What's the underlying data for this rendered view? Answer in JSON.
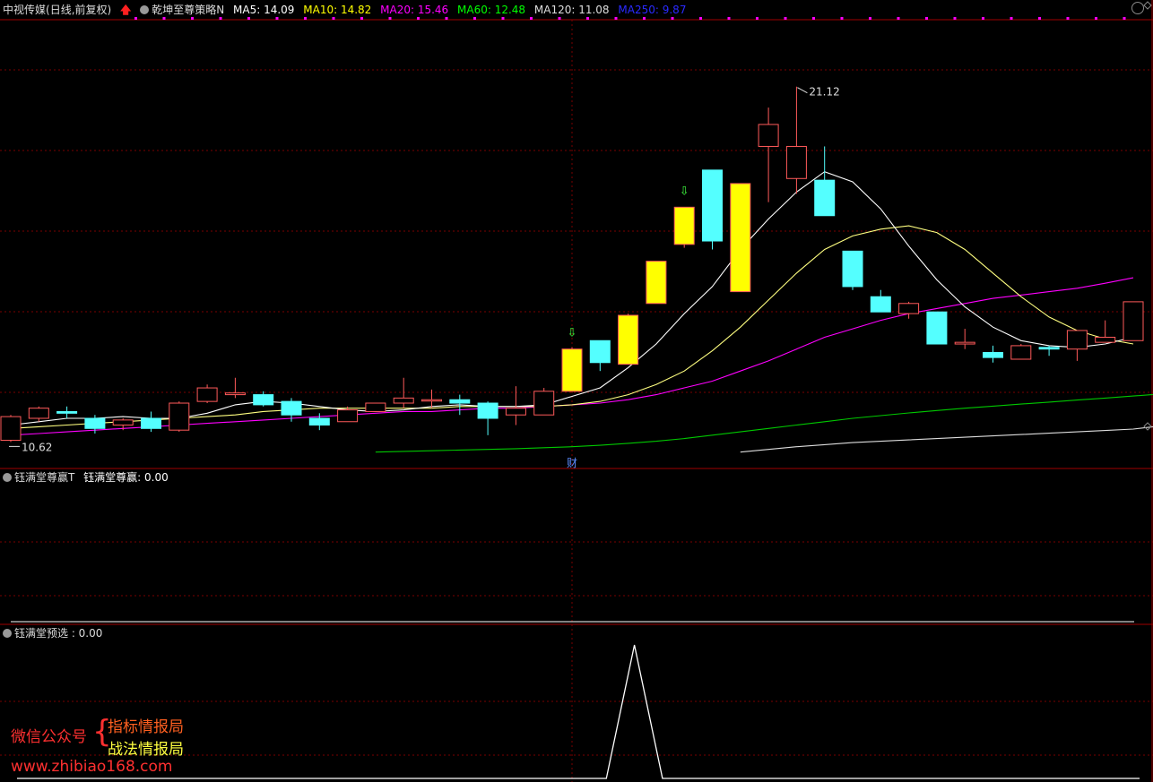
{
  "header": {
    "stock_name": "中视传媒",
    "period": "(日线,前复权)",
    "indicator_name": "乾坤至尊策略N",
    "ma": [
      {
        "label": "MA5: 14.09",
        "color": "#ffffff"
      },
      {
        "label": "MA10: 14.82",
        "color": "#ffff00"
      },
      {
        "label": "MA20: 15.46",
        "color": "#ff00ff"
      },
      {
        "label": "MA60: 12.48",
        "color": "#00ff00"
      },
      {
        "label": "MA120: 11.08",
        "color": "#dddddd"
      },
      {
        "label": "MA250: 9.87",
        "color": "#0000ff"
      }
    ]
  },
  "panel2": {
    "title": "钰满堂尊赢T",
    "value_label": "钰满堂尊赢: 0.00"
  },
  "panel3": {
    "title": "钰满堂预选 : 0.00"
  },
  "watermark": {
    "left": "微信公众号",
    "brace": "{",
    "line1": "指标情报局",
    "line2": "战法情报局",
    "url": "www.zhibiao168.com"
  },
  "chart_data": {
    "type": "candlestick",
    "colors": {
      "up": "#ff5a5a",
      "down": "#54ffff",
      "signal": "#ffff00",
      "ma5": "#ffffff",
      "ma10": "#ffff80",
      "ma20": "#ff00ff",
      "ma60": "#00c800",
      "ma120": "#dddddd"
    },
    "price_range": [
      10,
      22.2
    ],
    "candles": [
      {
        "o": 10.65,
        "h": 11.4,
        "l": 10.6,
        "c": 11.35
      },
      {
        "o": 11.3,
        "h": 11.65,
        "l": 11.2,
        "c": 11.6
      },
      {
        "o": 11.5,
        "h": 11.65,
        "l": 11.3,
        "c": 11.45
      },
      {
        "o": 11.3,
        "h": 11.4,
        "l": 10.85,
        "c": 11.0
      },
      {
        "o": 11.1,
        "h": 11.3,
        "l": 10.95,
        "c": 11.25
      },
      {
        "o": 11.3,
        "h": 11.5,
        "l": 10.9,
        "c": 11.0
      },
      {
        "o": 10.95,
        "h": 11.8,
        "l": 10.9,
        "c": 11.75
      },
      {
        "o": 11.8,
        "h": 12.3,
        "l": 11.75,
        "c": 12.2
      },
      {
        "o": 12.0,
        "h": 12.5,
        "l": 11.9,
        "c": 12.05
      },
      {
        "o": 12.0,
        "h": 12.1,
        "l": 11.65,
        "c": 11.7
      },
      {
        "o": 11.8,
        "h": 11.9,
        "l": 11.2,
        "c": 11.4
      },
      {
        "o": 11.3,
        "h": 11.45,
        "l": 10.95,
        "c": 11.1
      },
      {
        "o": 11.2,
        "h": 11.65,
        "l": 11.2,
        "c": 11.55
      },
      {
        "o": 11.5,
        "h": 11.75,
        "l": 11.5,
        "c": 11.75
      },
      {
        "o": 11.75,
        "h": 12.5,
        "l": 11.6,
        "c": 11.9
      },
      {
        "o": 11.85,
        "h": 12.15,
        "l": 11.6,
        "c": 11.85
      },
      {
        "o": 11.85,
        "h": 12.0,
        "l": 11.4,
        "c": 11.75
      },
      {
        "o": 11.75,
        "h": 11.8,
        "l": 10.8,
        "c": 11.3
      },
      {
        "o": 11.4,
        "h": 12.25,
        "l": 11.1,
        "c": 11.6
      },
      {
        "o": 11.4,
        "h": 12.2,
        "l": 11.4,
        "c": 12.1
      },
      {
        "o": 12.1,
        "h": 13.4,
        "l": 12.1,
        "c": 13.35,
        "signal": true,
        "arrow": true
      },
      {
        "o": 13.6,
        "h": 13.6,
        "l": 12.7,
        "c": 12.95
      },
      {
        "o": 12.9,
        "h": 14.4,
        "l": 12.9,
        "c": 14.35,
        "signal": true
      },
      {
        "o": 14.7,
        "h": 15.95,
        "l": 14.7,
        "c": 15.95,
        "signal": true
      },
      {
        "o": 16.45,
        "h": 16.9,
        "l": 16.35,
        "c": 17.55,
        "signal": true,
        "arrow": true
      },
      {
        "o": 18.65,
        "h": 18.65,
        "l": 16.3,
        "c": 16.55
      },
      {
        "o": 15.05,
        "h": 18.25,
        "l": 15.05,
        "c": 18.25,
        "signal": true
      },
      {
        "o": 19.35,
        "h": 20.5,
        "l": 17.7,
        "c": 20.0
      },
      {
        "o": 18.4,
        "h": 21.12,
        "l": 17.95,
        "c": 19.35
      },
      {
        "o": 18.35,
        "h": 19.35,
        "l": 17.3,
        "c": 17.3
      },
      {
        "o": 16.25,
        "h": 16.25,
        "l": 15.1,
        "c": 15.2
      },
      {
        "o": 14.9,
        "h": 15.1,
        "l": 14.45,
        "c": 14.45
      },
      {
        "o": 14.4,
        "h": 14.75,
        "l": 14.25,
        "c": 14.7
      },
      {
        "o": 14.45,
        "h": 14.45,
        "l": 13.5,
        "c": 13.5
      },
      {
        "o": 13.5,
        "h": 13.95,
        "l": 13.35,
        "c": 13.55
      },
      {
        "o": 13.25,
        "h": 13.45,
        "l": 12.95,
        "c": 13.1
      },
      {
        "o": 13.05,
        "h": 13.5,
        "l": 13.05,
        "c": 13.45
      },
      {
        "o": 13.4,
        "h": 13.45,
        "l": 13.15,
        "c": 13.35
      },
      {
        "o": 13.35,
        "h": 13.9,
        "l": 13.0,
        "c": 13.9
      },
      {
        "o": 13.55,
        "h": 14.2,
        "l": 13.55,
        "c": 13.7
      },
      {
        "o": 13.6,
        "h": 14.75,
        "l": 13.6,
        "c": 14.75
      }
    ],
    "ma5": [
      11.1,
      11.2,
      11.3,
      11.3,
      11.35,
      11.3,
      11.3,
      11.45,
      11.7,
      11.8,
      11.75,
      11.65,
      11.55,
      11.5,
      11.55,
      11.65,
      11.7,
      11.65,
      11.65,
      11.7,
      11.95,
      12.2,
      12.8,
      13.5,
      14.4,
      15.2,
      16.3,
      17.2,
      18.0,
      18.6,
      18.3,
      17.5,
      16.4,
      15.4,
      14.6,
      14.0,
      13.6,
      13.45,
      13.4,
      13.5,
      13.7
    ],
    "ma10": [
      11.0,
      11.05,
      11.1,
      11.15,
      11.2,
      11.25,
      11.3,
      11.35,
      11.4,
      11.5,
      11.55,
      11.6,
      11.6,
      11.6,
      11.6,
      11.6,
      11.65,
      11.65,
      11.65,
      11.65,
      11.7,
      11.8,
      12.0,
      12.3,
      12.7,
      13.3,
      14.0,
      14.8,
      15.6,
      16.3,
      16.7,
      16.9,
      17.0,
      16.8,
      16.3,
      15.6,
      14.9,
      14.3,
      13.9,
      13.65,
      13.5
    ],
    "ma20": [
      10.8,
      10.85,
      10.9,
      10.95,
      11.0,
      11.05,
      11.1,
      11.15,
      11.2,
      11.25,
      11.3,
      11.35,
      11.4,
      11.45,
      11.5,
      11.5,
      11.55,
      11.6,
      11.6,
      11.65,
      11.7,
      11.75,
      11.85,
      12.0,
      12.2,
      12.4,
      12.7,
      13.0,
      13.35,
      13.7,
      13.95,
      14.2,
      14.4,
      14.55,
      14.7,
      14.85,
      14.95,
      15.05,
      15.15,
      15.3,
      15.46
    ],
    "ma60_start": 13,
    "ma60": [
      10.3,
      10.32,
      10.34,
      10.36,
      10.38,
      10.4,
      10.43,
      10.46,
      10.5,
      10.56,
      10.62,
      10.7,
      10.8,
      10.9,
      11.0,
      11.1,
      11.2,
      11.3,
      11.38,
      11.46,
      11.53,
      11.6,
      11.66,
      11.72,
      11.78,
      11.84,
      11.9,
      11.96,
      12.02,
      12.08,
      12.14,
      12.2,
      12.48
    ],
    "ma120_start": 26,
    "ma120": [
      10.3,
      10.38,
      10.46,
      10.52,
      10.58,
      10.62,
      10.66,
      10.7,
      10.74,
      10.78,
      10.82,
      10.86,
      10.9,
      10.94,
      10.98,
      11.08
    ],
    "high_label": "21.12",
    "low_label": "10.62",
    "finance_marker": "财",
    "indicator3": [
      0,
      0,
      0,
      0,
      0,
      0,
      0,
      0,
      0,
      0,
      0,
      0,
      0,
      0,
      0,
      0,
      0,
      0,
      0,
      0,
      0,
      0,
      1,
      0,
      0,
      0,
      0,
      0,
      0,
      0,
      0,
      0,
      0,
      0,
      0,
      0,
      0,
      0,
      0,
      0,
      0
    ]
  }
}
